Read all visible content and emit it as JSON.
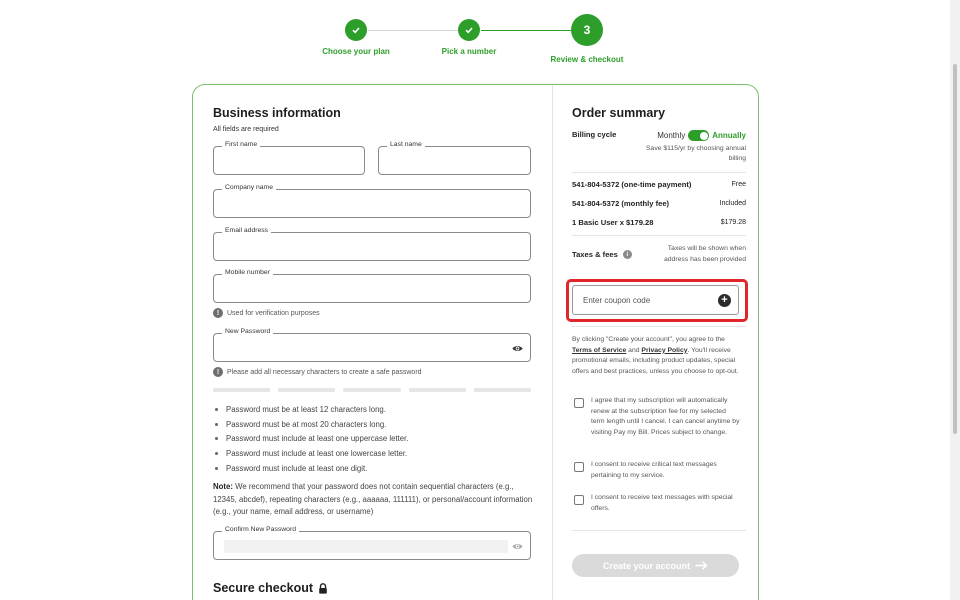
{
  "stepper": {
    "steps": [
      {
        "label": "Choose your plan",
        "state": "done"
      },
      {
        "label": "Pick a number",
        "state": "done"
      },
      {
        "label": "Review & checkout",
        "state": "current",
        "number": "3"
      }
    ],
    "accent": "#2e9e2a"
  },
  "business": {
    "title": "Business information",
    "required_note": "All fields are required",
    "first_name_label": "First name",
    "last_name_label": "Last name",
    "company_label": "Company name",
    "email_label": "Email address",
    "mobile_label": "Mobile number",
    "mobile_hint": "Used for verification purposes",
    "password_label": "New Password",
    "password_hint": "Please add all necessary characters to create a safe password",
    "password_rules": [
      "Password must be at least 12 characters long.",
      "Password must be at most 20 characters long.",
      "Password must include at least one uppercase letter.",
      "Password must include at least one lowercase letter.",
      "Password must include at least one digit."
    ],
    "note_label": "Note:",
    "note_text": " We recommend that your password does not contain sequential characters (e.g., 12345, abcdef), repeating characters (e.g., aaaaaa, 111111), or personal/account information (e.g., your name, email address, or username)",
    "confirm_label": "Confirm New Password",
    "secure_title": "Secure checkout"
  },
  "order": {
    "title": "Order summary",
    "billing_label": "Billing cycle",
    "monthly": "Monthly",
    "annually": "Annually",
    "save_text": "Save $115/yr by choosing annual billing",
    "items": [
      {
        "name": "541-804-5372 (one-time payment)",
        "value": "Free"
      },
      {
        "name": "541-804-5372 (monthly fee)",
        "value": "Included"
      },
      {
        "name": "1 Basic User x $179.28",
        "value": "$179.28"
      }
    ],
    "taxes_label": "Taxes & fees",
    "taxes_text": "Taxes will be shown when address has been provided",
    "coupon_placeholder": "Enter coupon code",
    "legal_pre": "By clicking \"Create your account\", you agree to the ",
    "tos": "Terms of Service",
    "and": " and ",
    "privacy": "Privacy Policy",
    "legal_post": ". You'll receive promotional emails, including product updates, special offers and best practices, unless you choose to opt-out.",
    "checks": [
      "I agree that my subscription will automatically renew at the subscription fee for my selected term length until I cancel. I can cancel anytime by visiting Pay my Bill. Prices subject to change.",
      "I consent to receive critical text messages pertaining to my service.",
      "I consent to receive text messages with special offers."
    ],
    "create_button": "Create your account",
    "highlight_color": "#e0262b"
  }
}
